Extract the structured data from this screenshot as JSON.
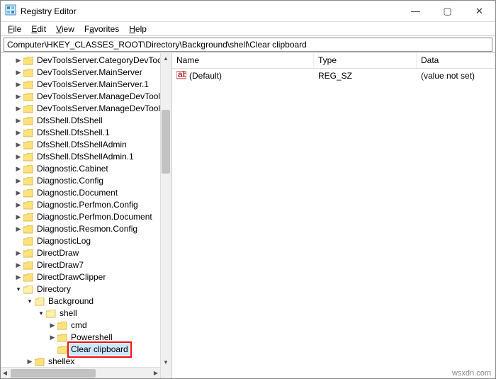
{
  "title": "Registry Editor",
  "menu": {
    "file": "File",
    "edit": "Edit",
    "view": "View",
    "favorites": "Favorites",
    "help": "Help"
  },
  "address": "Computer\\HKEY_CLASSES_ROOT\\Directory\\Background\\shell\\Clear clipboard",
  "tree": [
    {
      "i": 1,
      "c": ">",
      "t": "DevToolsServer.CategoryDevTools",
      "cut": true
    },
    {
      "i": 1,
      "c": ">",
      "t": "DevToolsServer.MainServer"
    },
    {
      "i": 1,
      "c": ">",
      "t": "DevToolsServer.MainServer.1"
    },
    {
      "i": 1,
      "c": ">",
      "t": "DevToolsServer.ManageDevTools"
    },
    {
      "i": 1,
      "c": ">",
      "t": "DevToolsServer.ManageDevTools.",
      "cut": true
    },
    {
      "i": 1,
      "c": ">",
      "t": "DfsShell.DfsShell"
    },
    {
      "i": 1,
      "c": ">",
      "t": "DfsShell.DfsShell.1"
    },
    {
      "i": 1,
      "c": ">",
      "t": "DfsShell.DfsShellAdmin"
    },
    {
      "i": 1,
      "c": ">",
      "t": "DfsShell.DfsShellAdmin.1"
    },
    {
      "i": 1,
      "c": ">",
      "t": "Diagnostic.Cabinet"
    },
    {
      "i": 1,
      "c": ">",
      "t": "Diagnostic.Config"
    },
    {
      "i": 1,
      "c": ">",
      "t": "Diagnostic.Document"
    },
    {
      "i": 1,
      "c": ">",
      "t": "Diagnostic.Perfmon.Config"
    },
    {
      "i": 1,
      "c": ">",
      "t": "Diagnostic.Perfmon.Document"
    },
    {
      "i": 1,
      "c": ">",
      "t": "Diagnostic.Resmon.Config"
    },
    {
      "i": 1,
      "c": "",
      "t": "DiagnosticLog"
    },
    {
      "i": 1,
      "c": ">",
      "t": "DirectDraw"
    },
    {
      "i": 1,
      "c": ">",
      "t": "DirectDraw7"
    },
    {
      "i": 1,
      "c": ">",
      "t": "DirectDrawClipper"
    },
    {
      "i": 1,
      "c": "v",
      "t": "Directory"
    },
    {
      "i": 2,
      "c": "v",
      "t": "Background"
    },
    {
      "i": 3,
      "c": "v",
      "t": "shell"
    },
    {
      "i": 4,
      "c": ">",
      "t": "cmd"
    },
    {
      "i": 4,
      "c": ">",
      "t": "Powershell"
    },
    {
      "i": 4,
      "c": "",
      "t": "Clear clipboard",
      "sel": true
    },
    {
      "i": 2,
      "c": ">",
      "t": "shellex"
    }
  ],
  "list": {
    "headers": {
      "name": "Name",
      "type": "Type",
      "data": "Data"
    },
    "rows": [
      {
        "icon": "ab",
        "name": "(Default)",
        "type": "REG_SZ",
        "data": "(value not set)"
      }
    ]
  },
  "watermark": "wsxdn.com"
}
